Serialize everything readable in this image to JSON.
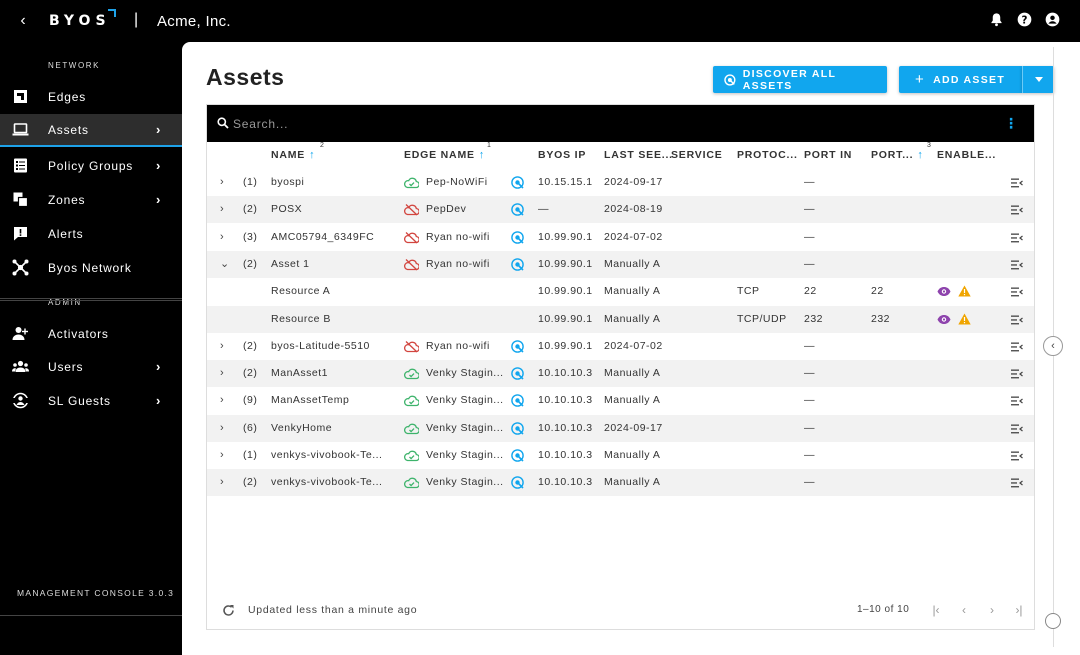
{
  "topbar": {
    "logo_text": "BYOS",
    "separator": "|",
    "org_name": "Acme, Inc.",
    "icons": [
      "bell-icon",
      "help-icon",
      "account-icon"
    ]
  },
  "sidebar": {
    "network_section": "NETWORK",
    "admin_section": "ADMIN",
    "items": [
      {
        "label": "Edges",
        "icon": "edges-icon",
        "has_chevron": false
      },
      {
        "label": "Assets",
        "icon": "laptop-icon",
        "has_chevron": true,
        "active": true
      },
      {
        "label": "Policy Groups",
        "icon": "policy-icon",
        "has_chevron": true
      },
      {
        "label": "Zones",
        "icon": "zones-icon",
        "has_chevron": true
      },
      {
        "label": "Alerts",
        "icon": "alert-icon",
        "has_chevron": false
      },
      {
        "label": "Byos Network",
        "icon": "network-icon",
        "has_chevron": false
      },
      {
        "label": "Activators",
        "icon": "activators-icon",
        "has_chevron": false
      },
      {
        "label": "Users",
        "icon": "users-icon",
        "has_chevron": true
      },
      {
        "label": "SL Guests",
        "icon": "guests-icon",
        "has_chevron": true
      }
    ],
    "version": "MANAGEMENT CONSOLE 3.0.3",
    "accent_color": "#1ea2e8"
  },
  "main": {
    "title": "Assets",
    "discover_button": "DISCOVER ALL ASSETS",
    "add_button": "ADD ASSET",
    "search_placeholder": "Search...",
    "columns": {
      "name": "NAME",
      "name_sort": "2",
      "edge_name": "EDGE NAME",
      "edge_sort": "1",
      "byos_ip": "BYOS IP",
      "last_seen": "LAST SEE...",
      "service": "SERVICE",
      "protocol": "PROTOC...",
      "port_in": "PORT IN",
      "port_out": "PORT...",
      "port_out_sort": "3",
      "enabled": "ENABLE..."
    },
    "rows": [
      {
        "expander": "›",
        "count": "(1)",
        "name": "byospi",
        "edge": "Pep-NoWiFi",
        "edge_status": "online",
        "disc": true,
        "ip": "10.15.15.1",
        "last_seen": "2024-09-17",
        "protocol": "",
        "port_in": "—",
        "port_out": "",
        "indicators": false
      },
      {
        "expander": "›",
        "count": "(2)",
        "name": "POSX",
        "edge": "PepDev",
        "edge_status": "offline",
        "disc": true,
        "ip": "—",
        "last_seen": "2024-08-19",
        "protocol": "",
        "port_in": "—",
        "port_out": "",
        "indicators": false
      },
      {
        "expander": "›",
        "count": "(3)",
        "name": "AMC05794_6349FC",
        "edge": "Ryan no-wifi",
        "edge_status": "offline",
        "disc": true,
        "ip": "10.99.90.1",
        "last_seen": "2024-07-02",
        "protocol": "",
        "port_in": "—",
        "port_out": "",
        "indicators": false
      },
      {
        "expander": "⌄",
        "count": "(2)",
        "name": "Asset 1",
        "edge": "Ryan no-wifi",
        "edge_status": "offline",
        "disc": true,
        "ip": "10.99.90.1",
        "last_seen": "Manually A",
        "protocol": "",
        "port_in": "—",
        "port_out": "",
        "indicators": false
      },
      {
        "expander": "",
        "count": "",
        "name": "Resource A",
        "edge": "",
        "edge_status": "",
        "disc": false,
        "ip": "10.99.90.1",
        "last_seen": "Manually A",
        "protocol": "TCP",
        "port_in": "22",
        "port_out": "22",
        "indicators": true
      },
      {
        "expander": "",
        "count": "",
        "name": "Resource B",
        "edge": "",
        "edge_status": "",
        "disc": false,
        "ip": "10.99.90.1",
        "last_seen": "Manually A",
        "protocol": "TCP/UDP",
        "port_in": "232",
        "port_out": "232",
        "indicators": true
      },
      {
        "expander": "›",
        "count": "(2)",
        "name": "byos-Latitude-5510",
        "edge": "Ryan no-wifi",
        "edge_status": "offline",
        "disc": true,
        "ip": "10.99.90.1",
        "last_seen": "2024-07-02",
        "protocol": "",
        "port_in": "—",
        "port_out": "",
        "indicators": false
      },
      {
        "expander": "›",
        "count": "(2)",
        "name": "ManAsset1",
        "edge": "Venky Stagin...",
        "edge_status": "online",
        "disc": true,
        "ip": "10.10.10.3",
        "last_seen": "Manually A",
        "protocol": "",
        "port_in": "—",
        "port_out": "",
        "indicators": false
      },
      {
        "expander": "›",
        "count": "(9)",
        "name": "ManAssetTemp",
        "edge": "Venky Stagin...",
        "edge_status": "online",
        "disc": true,
        "ip": "10.10.10.3",
        "last_seen": "Manually A",
        "protocol": "",
        "port_in": "—",
        "port_out": "",
        "indicators": false
      },
      {
        "expander": "›",
        "count": "(6)",
        "name": "VenkyHome",
        "edge": "Venky Stagin...",
        "edge_status": "online",
        "disc": true,
        "ip": "10.10.10.3",
        "last_seen": "2024-09-17",
        "protocol": "",
        "port_in": "—",
        "port_out": "",
        "indicators": false
      },
      {
        "expander": "›",
        "count": "(1)",
        "name": "venkys-vivobook-Te...",
        "edge": "Venky Stagin...",
        "edge_status": "online",
        "disc": true,
        "ip": "10.10.10.3",
        "last_seen": "Manually A",
        "protocol": "",
        "port_in": "—",
        "port_out": "",
        "indicators": false
      },
      {
        "expander": "›",
        "count": "(2)",
        "name": "venkys-vivobook-Te...",
        "edge": "Venky Stagin...",
        "edge_status": "online",
        "disc": true,
        "ip": "10.10.10.3",
        "last_seen": "Manually A",
        "protocol": "",
        "port_in": "—",
        "port_out": "",
        "indicators": false
      }
    ],
    "footer": {
      "updated": "Updated less than a minute ago",
      "range": "1–10 of 10"
    },
    "colors": {
      "accent": "#11a6ee",
      "online": "#3db36b",
      "offline": "#d2453f",
      "eye": "#8e44ad",
      "warning": "#f0a500"
    }
  }
}
